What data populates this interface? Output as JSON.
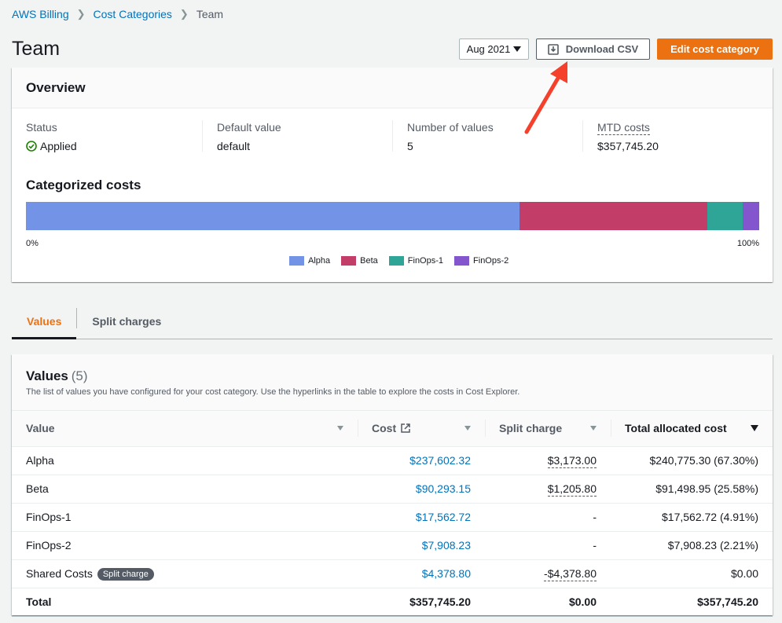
{
  "breadcrumb": [
    "AWS Billing",
    "Cost Categories",
    "Team"
  ],
  "page": {
    "title": "Team",
    "date_label": "Aug 2021",
    "download_label": "Download CSV",
    "edit_label": "Edit cost category"
  },
  "overview": {
    "title": "Overview",
    "status_label": "Status",
    "status_value": "Applied",
    "default_label": "Default value",
    "default_value": "default",
    "count_label": "Number of values",
    "count_value": "5",
    "mtd_label": "MTD costs",
    "mtd_value": "$357,745.20"
  },
  "categorized": {
    "title": "Categorized costs",
    "axis_start": "0%",
    "axis_end": "100%",
    "segments": [
      {
        "name": "Alpha",
        "percent": 67.3,
        "color": "#7393e6"
      },
      {
        "name": "Beta",
        "percent": 25.58,
        "color": "#c33d69"
      },
      {
        "name": "FinOps-1",
        "percent": 4.91,
        "color": "#2ea597"
      },
      {
        "name": "FinOps-2",
        "percent": 2.21,
        "color": "#8456ce"
      }
    ]
  },
  "tabs": [
    "Values",
    "Split charges"
  ],
  "values": {
    "title": "Values",
    "count": "(5)",
    "description": "The list of values you have configured for your cost category. Use the hyperlinks in the table to explore the costs in Cost Explorer.",
    "columns": [
      "Value",
      "Cost",
      "Split charge",
      "Total allocated cost"
    ],
    "rows": [
      {
        "value": "Alpha",
        "cost": "$237,602.32",
        "split": "$3,173.00",
        "total": "$240,775.30 (67.30%)"
      },
      {
        "value": "Beta",
        "cost": "$90,293.15",
        "split": "$1,205.80",
        "total": "$91,498.95 (25.58%)"
      },
      {
        "value": "FinOps-1",
        "cost": "$17,562.72",
        "split": "-",
        "total": "$17,562.72 (4.91%)"
      },
      {
        "value": "FinOps-2",
        "cost": "$7,908.23",
        "split": "-",
        "total": "$7,908.23 (2.21%)"
      },
      {
        "value": "Shared Costs",
        "badge": "Split charge",
        "cost": "$4,378.80",
        "split": "-$4,378.80",
        "total": "$0.00"
      }
    ],
    "total_row": {
      "value": "Total",
      "cost": "$357,745.20",
      "split": "$0.00",
      "total": "$357,745.20"
    }
  },
  "colors": {
    "accent": "#ec7211",
    "link": "#0073bb",
    "success": "#1d8102",
    "annotation_arrow": "#f5402c"
  }
}
